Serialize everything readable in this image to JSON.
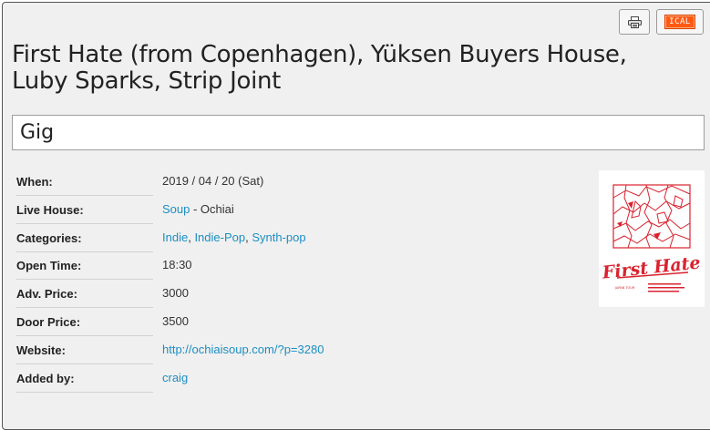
{
  "toolbar": {
    "print_icon": "printer-icon",
    "ical_label": "ICAL"
  },
  "event": {
    "title": "First Hate (from Copenhagen), Yüksen Buyers House, Luby Sparks, Strip Joint",
    "type": "Gig"
  },
  "details": {
    "when": {
      "label": "When:",
      "value": "2019 / 04 / 20 (Sat)"
    },
    "live_house": {
      "label": "Live House:",
      "link": "Soup",
      "suffix": " - Ochiai"
    },
    "categories": {
      "label": "Categories:",
      "items": [
        "Indie",
        "Indie-Pop",
        "Synth-pop"
      ],
      "separator": ", "
    },
    "open_time": {
      "label": "Open Time:",
      "value": "18:30"
    },
    "adv_price": {
      "label": "Adv. Price:",
      "value": "3000"
    },
    "door_price": {
      "label": "Door Price:",
      "value": "3500"
    },
    "website": {
      "label": "Website:",
      "link": "http://ochiaisoup.com/?p=3280"
    },
    "added_by": {
      "label": "Added by:",
      "link": "craig"
    }
  },
  "poster": {
    "text": "First Hate",
    "subtext": "JAPAN TOUR",
    "accent": "#d9232f"
  },
  "colors": {
    "link": "#1c8fc3",
    "panel": "#f0f0f0",
    "ical": "#ff5a14"
  }
}
